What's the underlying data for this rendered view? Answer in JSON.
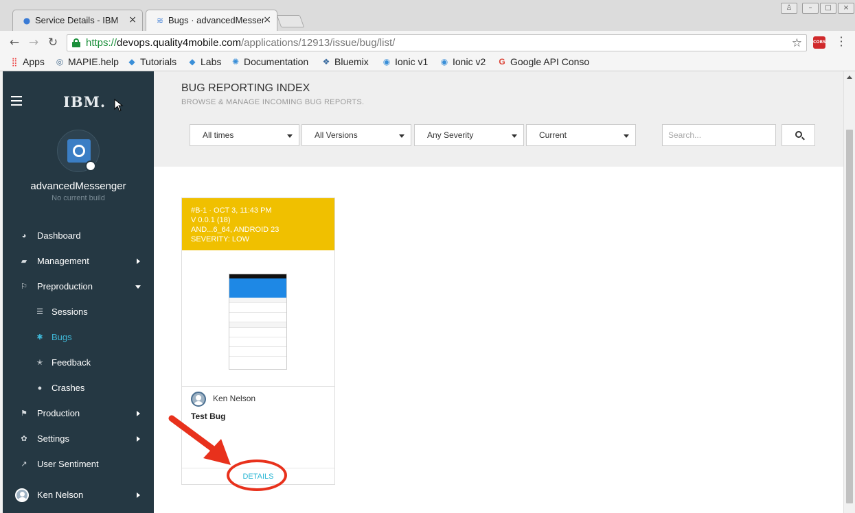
{
  "browser": {
    "tabs": [
      {
        "title": "Service Details - IBM",
        "close": "×"
      },
      {
        "title": "Bugs · advancedMessenger",
        "close": "×"
      }
    ],
    "url": {
      "scheme": "https://",
      "host": "devops.quality4mobile.com",
      "path": "/applications/12913/issue/bug/list/"
    },
    "extension_label": "CORS",
    "bookmarks": [
      {
        "label": "Apps",
        "icon": "apps-grid-icon"
      },
      {
        "label": "MAPIE.help",
        "icon": "mapie-icon"
      },
      {
        "label": "Tutorials",
        "icon": "tutorials-icon"
      },
      {
        "label": "Labs",
        "icon": "labs-icon"
      },
      {
        "label": "Documentation",
        "icon": "documentation-icon"
      },
      {
        "label": "Bluemix",
        "icon": "bluemix-icon"
      },
      {
        "label": "Ionic v1",
        "icon": "ionic-icon"
      },
      {
        "label": "Ionic v2",
        "icon": "ionic-icon"
      },
      {
        "label": "Google API Conso",
        "icon": "google-icon"
      }
    ]
  },
  "sidebar": {
    "logo": "IBM.",
    "app_name": "advancedMessenger",
    "app_sub": "No current build",
    "items": [
      {
        "label": "Dashboard",
        "icon": "dashboard-icon"
      },
      {
        "label": "Management",
        "icon": "briefcase-icon"
      },
      {
        "label": "Preproduction",
        "icon": "flag-outline-icon"
      },
      {
        "label": "Sessions",
        "icon": "list-icon"
      },
      {
        "label": "Bugs",
        "icon": "bug-icon"
      },
      {
        "label": "Feedback",
        "icon": "star-half-icon"
      },
      {
        "label": "Crashes",
        "icon": "info-icon"
      },
      {
        "label": "Production",
        "icon": "flag-checkered-icon"
      },
      {
        "label": "Settings",
        "icon": "gear-icon"
      },
      {
        "label": "User Sentiment",
        "icon": "line-chart-icon"
      }
    ],
    "user": "Ken Nelson"
  },
  "main": {
    "title": "BUG REPORTING INDEX",
    "subtitle": "BROWSE & MANAGE INCOMING BUG REPORTS.",
    "filters": [
      "All times",
      "All Versions",
      "Any Severity",
      "Current"
    ],
    "search_placeholder": "Search...",
    "card": {
      "line1": "#B-1 · OCT 3, 11:43 PM",
      "line2": "V 0.0.1 (18)",
      "line3": "AND...6_64, ANDROID 23",
      "line4": "SEVERITY: LOW",
      "header_color": "#f0c000",
      "author": "Ken Nelson",
      "title": "Test Bug",
      "details": "DETAILS"
    }
  },
  "colors": {
    "sidebar_bg": "#253843",
    "accent": "#3fb8d8",
    "annotation": "#e8311c"
  }
}
